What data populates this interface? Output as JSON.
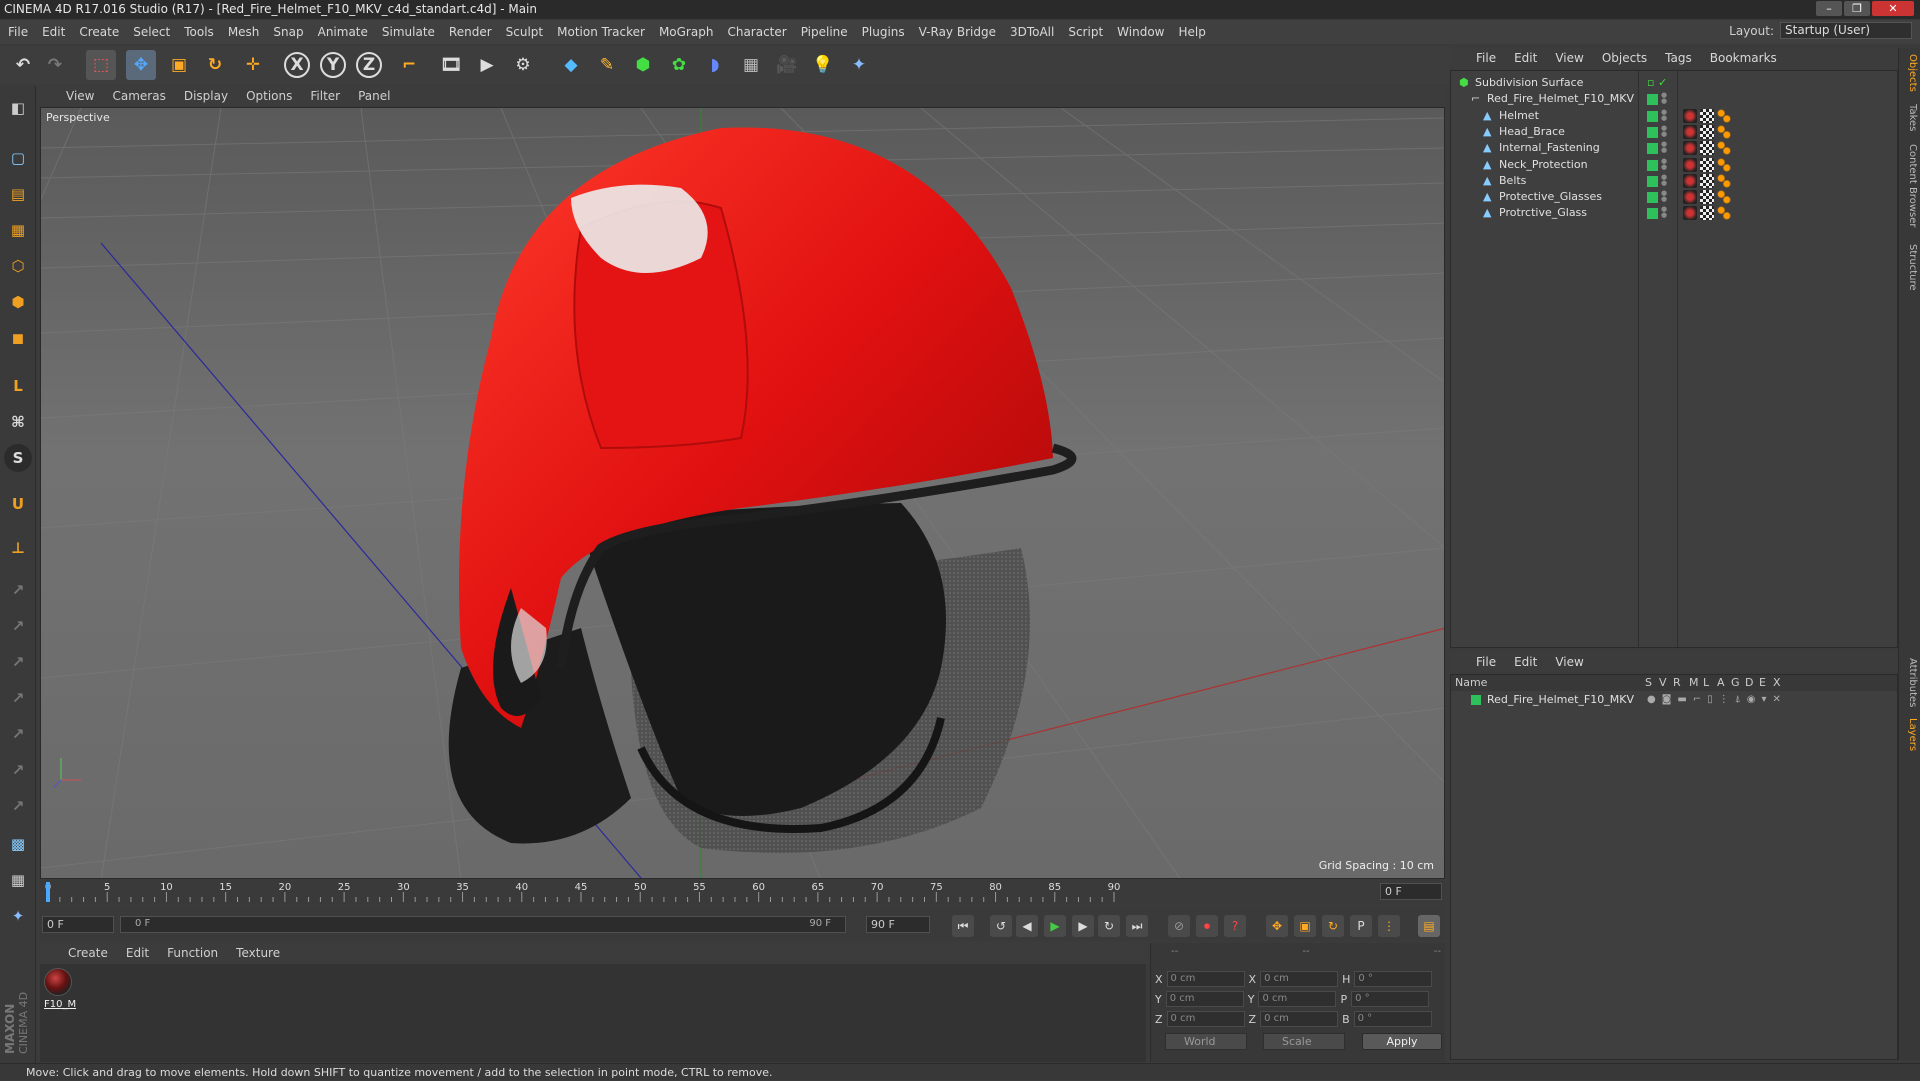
{
  "window": {
    "title": "CINEMA 4D R17.016 Studio (R17) - [Red_Fire_Helmet_F10_MKV_c4d_standart.c4d] - Main",
    "controls": [
      "–",
      "❐",
      "✕"
    ]
  },
  "menubar": {
    "items": [
      "File",
      "Edit",
      "Create",
      "Select",
      "Tools",
      "Mesh",
      "Snap",
      "Animate",
      "Simulate",
      "Render",
      "Sculpt",
      "Motion Tracker",
      "MoGraph",
      "Character",
      "Pipeline",
      "Plugins",
      "V-Ray Bridge",
      "3DToAll",
      "Script",
      "Window",
      "Help"
    ],
    "layout_label": "Layout:",
    "layout_value": "Startup (User)"
  },
  "toolbar": {
    "axis_x": "X",
    "axis_y": "Y",
    "axis_z": "Z"
  },
  "viewport": {
    "menu": [
      "View",
      "Cameras",
      "Display",
      "Options",
      "Filter",
      "Panel"
    ],
    "label": "Perspective",
    "grid_spacing": "Grid Spacing : 10 cm"
  },
  "timeline": {
    "ticks": [
      "0",
      "5",
      "10",
      "15",
      "20",
      "25",
      "30",
      "35",
      "40",
      "45",
      "50",
      "55",
      "60",
      "65",
      "70",
      "75",
      "80",
      "85",
      "90"
    ],
    "current_frame_right": "0 F",
    "start_field": "0 F",
    "range_start": "0 F",
    "range_end": "90 F",
    "end_field": "90 F"
  },
  "material_manager": {
    "menu": [
      "Create",
      "Edit",
      "Function",
      "Texture"
    ],
    "material_name": "F10_M"
  },
  "coordinates": {
    "header": [
      "--",
      "--",
      "--"
    ],
    "rows": [
      {
        "a": "X",
        "av": "0 cm",
        "b": "X",
        "bv": "0 cm",
        "c": "H",
        "cv": "0 °"
      },
      {
        "a": "Y",
        "av": "0 cm",
        "b": "Y",
        "bv": "0 cm",
        "c": "P",
        "cv": "0 °"
      },
      {
        "a": "Z",
        "av": "0 cm",
        "b": "Z",
        "bv": "0 cm",
        "c": "B",
        "cv": "0 °"
      }
    ],
    "world": "World",
    "scale": "Scale",
    "apply": "Apply"
  },
  "object_manager": {
    "menu": [
      "File",
      "Edit",
      "View",
      "Objects",
      "Tags",
      "Bookmarks"
    ],
    "objects": [
      {
        "name": "Subdivision Surface",
        "depth": 0
      },
      {
        "name": "Red_Fire_Helmet_F10_MKV",
        "depth": 1
      },
      {
        "name": "Helmet",
        "depth": 2
      },
      {
        "name": "Head_Brace",
        "depth": 2
      },
      {
        "name": "Internal_Fastening",
        "depth": 2
      },
      {
        "name": "Neck_Protection",
        "depth": 2
      },
      {
        "name": "Belts",
        "depth": 2
      },
      {
        "name": "Protective_Glasses",
        "depth": 2
      },
      {
        "name": "Protrctive_Glass",
        "depth": 2
      }
    ]
  },
  "layer_manager": {
    "menu": [
      "File",
      "Edit",
      "View"
    ],
    "columns": [
      "Name",
      "S",
      "V",
      "R",
      "M",
      "L",
      "A",
      "G",
      "D",
      "E",
      "X"
    ],
    "layer": "Red_Fire_Helmet_F10_MKV"
  },
  "right_dock": {
    "tabs": [
      "Objects",
      "Takes",
      "Content Browser",
      "Structure",
      "Attributes",
      "Layers"
    ]
  },
  "left_tools": {
    "labels": [
      "L",
      "S"
    ]
  },
  "branding": {
    "maxon": "MAXON",
    "cinema": "CINEMA 4D"
  },
  "status": "Move: Click and drag to move elements. Hold down SHIFT to quantize movement / add to the selection in point mode, CTRL to remove.",
  "colors": {
    "helmet_red": "#e01010",
    "layer_green": "#2ec05a",
    "axis_x": "#c84040",
    "axis_y": "#40c040",
    "axis_z": "#4040c8"
  }
}
